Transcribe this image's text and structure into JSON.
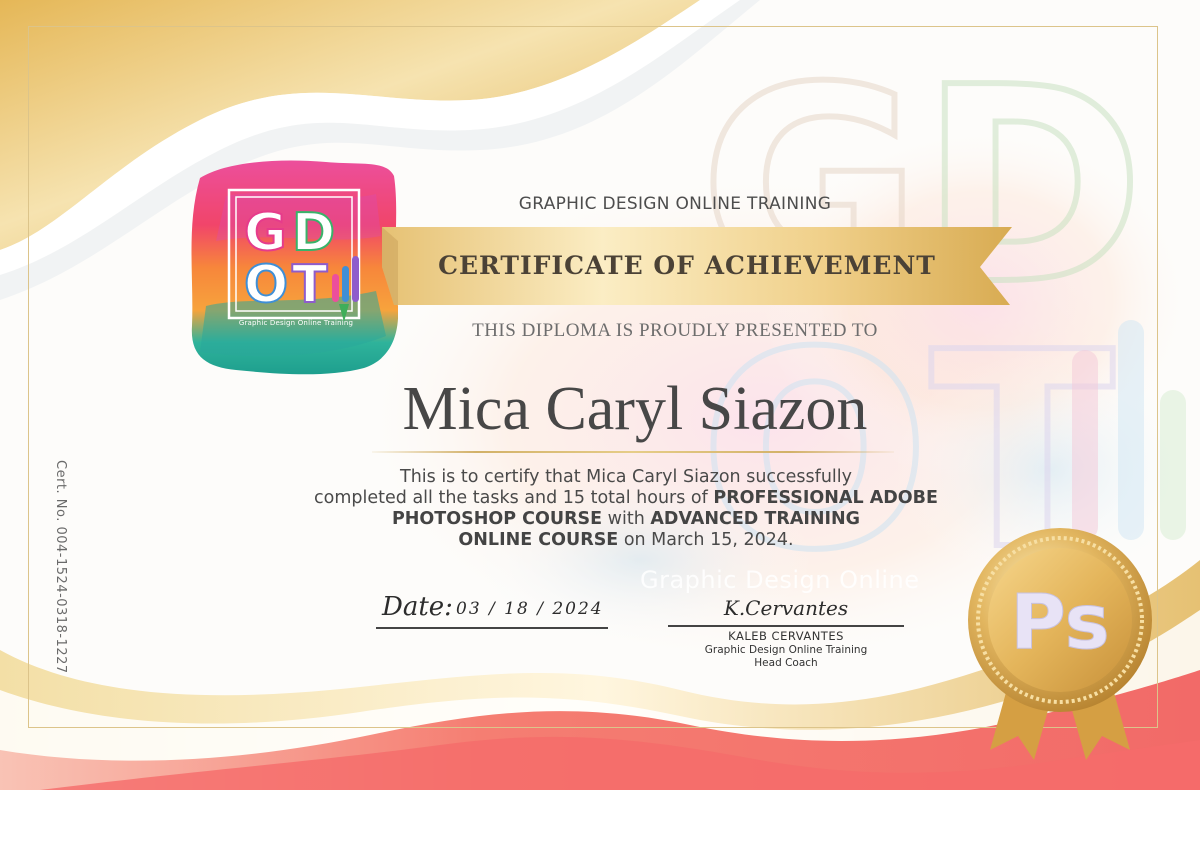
{
  "organization": "GRAPHIC DESIGN ONLINE TRAINING",
  "certificate_title": "CERTIFICATE OF ACHIEVEMENT",
  "presented_line": "THIS DIPLOMA IS PROUDLY  PRESENTED TO",
  "recipient_name": "Mica Caryl Siazon",
  "body": {
    "line1": "This is to certify that Mica Caryl Siazon successfully",
    "line2_plain": "completed all the tasks and 15 total hours of ",
    "line2_bold": "PROFESSIONAL ADOBE",
    "line3_bold_a": "PHOTOSHOP COURSE",
    "line3_plain": " with ",
    "line3_bold_b": "ADVANCED TRAINING",
    "line4_bold": "ONLINE COURSE",
    "line4_plain": " on March 15, 2024."
  },
  "cert_number": "Cert. No. 004-1524-0318-1227",
  "date": {
    "label": "Date:",
    "value": "03  /  18  /  2024"
  },
  "signatory": {
    "signature": "K.Cervantes",
    "name": "KALEB CERVANTES",
    "organization": "Graphic Design Online Training",
    "role": "Head Coach"
  },
  "logo": {
    "letters": [
      "G",
      "D",
      "O",
      "T"
    ],
    "tagline": "Graphic Design Online Training"
  },
  "watermark": {
    "letters": [
      "G",
      "D",
      "O",
      "T"
    ],
    "text": "Graphic Design Online"
  },
  "medal": {
    "label": "Ps"
  },
  "colors": {
    "gold": "#e3c27a",
    "coral": "#f36f6b",
    "ribbon_text": "#4b4236",
    "ps_blue": "#e8e3f6"
  }
}
